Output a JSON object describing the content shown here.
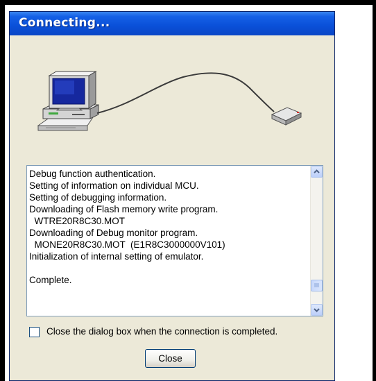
{
  "window": {
    "title": "Connecting..."
  },
  "illustration": {
    "description_icons": [
      "computer-icon",
      "cable",
      "emulator-device-icon"
    ]
  },
  "log": {
    "lines": [
      "Debug function authentication.",
      "Setting of information on individual MCU.",
      "Setting of debugging information.",
      "Downloading of Flash memory write program.",
      "  WTRE20R8C30.MOT",
      "Downloading of Debug monitor program.",
      "  MONE20R8C30.MOT  (E1R8C3000000V101)",
      "Initialization of internal setting of emulator.",
      "",
      "Complete."
    ]
  },
  "options": {
    "close_on_complete_label": "Close the dialog box when the connection is completed.",
    "close_on_complete_checked": false
  },
  "buttons": {
    "close_label": "Close"
  },
  "colors": {
    "title_bar": "#0a50d8",
    "dialog_bg": "#ece9d8",
    "scroll_accent": "#4d6185"
  }
}
